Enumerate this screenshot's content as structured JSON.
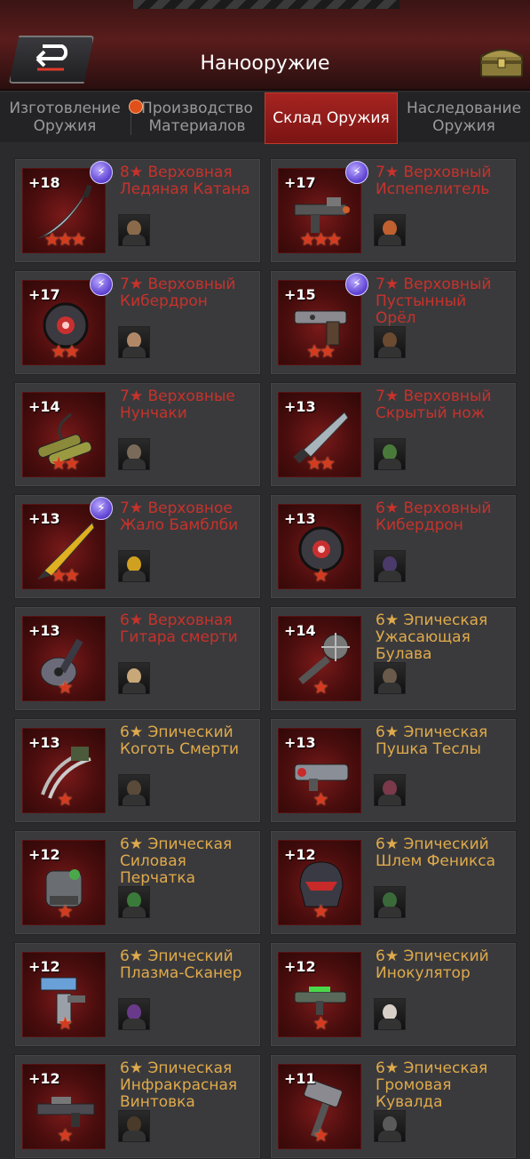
{
  "header": {
    "title": "Нанооружие",
    "back_icon": "back-arrow-icon",
    "chest_icon": "treasure-chest-icon"
  },
  "tabs": [
    {
      "label": "Изготовление\nОружия",
      "active": false
    },
    {
      "label": "Производство\nМатериалов",
      "active": false
    },
    {
      "label": "Склад Оружия",
      "active": true
    },
    {
      "label": "Наследование\nОружия",
      "active": false
    }
  ],
  "colors": {
    "supreme_name": "#c8322a",
    "epic_name": "#e0aa4a",
    "accent_red": "#a62420",
    "badge_purple": "#5b3fd0"
  },
  "weapons": [
    {
      "level": "+18",
      "name": "8★ Верховная\nЛедяная Катана",
      "stars": "★★★",
      "tier": "red",
      "badge": true,
      "icon": "katana-icon",
      "avatar_color": "#8a6a4a"
    },
    {
      "level": "+17",
      "name": "7★ Верховный\nИспепелитель",
      "stars": "★★★",
      "tier": "red",
      "badge": true,
      "icon": "flamethrower-icon",
      "avatar_color": "#c06030"
    },
    {
      "level": "+17",
      "name": "7★ Верховный\nКибердрон",
      "stars": "★★",
      "tier": "red",
      "badge": true,
      "icon": "cyberdrone-icon",
      "avatar_color": "#b08868"
    },
    {
      "level": "+15",
      "name": "7★ Верховный\nПустынный\nОрёл",
      "stars": "★★",
      "tier": "red",
      "badge": true,
      "icon": "pistol-icon",
      "avatar_color": "#6a4a30"
    },
    {
      "level": "+14",
      "name": "7★ Верховные\nНунчаки",
      "stars": "★★",
      "tier": "red",
      "badge": false,
      "icon": "nunchaku-icon",
      "avatar_color": "#7a6a5a"
    },
    {
      "level": "+13",
      "name": "7★ Верховный\nСкрытый нож",
      "stars": "★★",
      "tier": "red",
      "badge": false,
      "icon": "knife-icon",
      "avatar_color": "#4a7a3a"
    },
    {
      "level": "+13",
      "name": "7★ Верховное\nЖало Бамблби",
      "stars": "★★",
      "tier": "red",
      "badge": true,
      "icon": "stinger-icon",
      "avatar_color": "#d0a020"
    },
    {
      "level": "+13",
      "name": "6★ Верховный\nКибердрон",
      "stars": "★",
      "tier": "red",
      "badge": false,
      "icon": "cyberdrone-icon",
      "avatar_color": "#4a3a6a"
    },
    {
      "level": "+13",
      "name": "6★ Верховная\nГитара смерти",
      "stars": "★",
      "tier": "red",
      "badge": false,
      "icon": "guitar-icon",
      "avatar_color": "#c8a878"
    },
    {
      "level": "+14",
      "name": "6★ Эпическая\nУжасающая\nБулава",
      "stars": "★",
      "tier": "gold",
      "badge": false,
      "icon": "mace-icon",
      "avatar_color": "#6a5a4a"
    },
    {
      "level": "+13",
      "name": "6★ Эпический\nКоготь Смерти",
      "stars": "★",
      "tier": "gold",
      "badge": false,
      "icon": "claw-icon",
      "avatar_color": "#5a4a3a"
    },
    {
      "level": "+13",
      "name": "6★ Эпическая\nПушка Теслы",
      "stars": "★",
      "tier": "gold",
      "badge": false,
      "icon": "tesla-cannon-icon",
      "avatar_color": "#7a3a4a"
    },
    {
      "level": "+12",
      "name": "6★ Эпическая\nСиловая\nПерчатка",
      "stars": "★",
      "tier": "gold",
      "badge": false,
      "icon": "gauntlet-icon",
      "avatar_color": "#3a7a3a"
    },
    {
      "level": "+12",
      "name": "6★ Эпический\nШлем Феникса",
      "stars": "★",
      "tier": "gold",
      "badge": false,
      "icon": "helmet-icon",
      "avatar_color": "#3a6a3a"
    },
    {
      "level": "+12",
      "name": "6★ Эпический\nПлазма-Сканер",
      "stars": "★",
      "tier": "gold",
      "badge": false,
      "icon": "scanner-icon",
      "avatar_color": "#6a3a8a"
    },
    {
      "level": "+12",
      "name": "6★ Эпический\nИнокулятор",
      "stars": "★",
      "tier": "gold",
      "badge": false,
      "icon": "injector-icon",
      "avatar_color": "#d8d0c8"
    },
    {
      "level": "+12",
      "name": "6★ Эпическая\nИнфракрасная\nВинтовка",
      "stars": "★",
      "tier": "gold",
      "badge": false,
      "icon": "rifle-icon",
      "avatar_color": "#4a3a2a"
    },
    {
      "level": "+11",
      "name": "6★ Эпическая\nГромовая\nКувалда",
      "stars": "★",
      "tier": "gold",
      "badge": false,
      "icon": "hammer-icon",
      "avatar_color": "#5a5a5a"
    }
  ]
}
